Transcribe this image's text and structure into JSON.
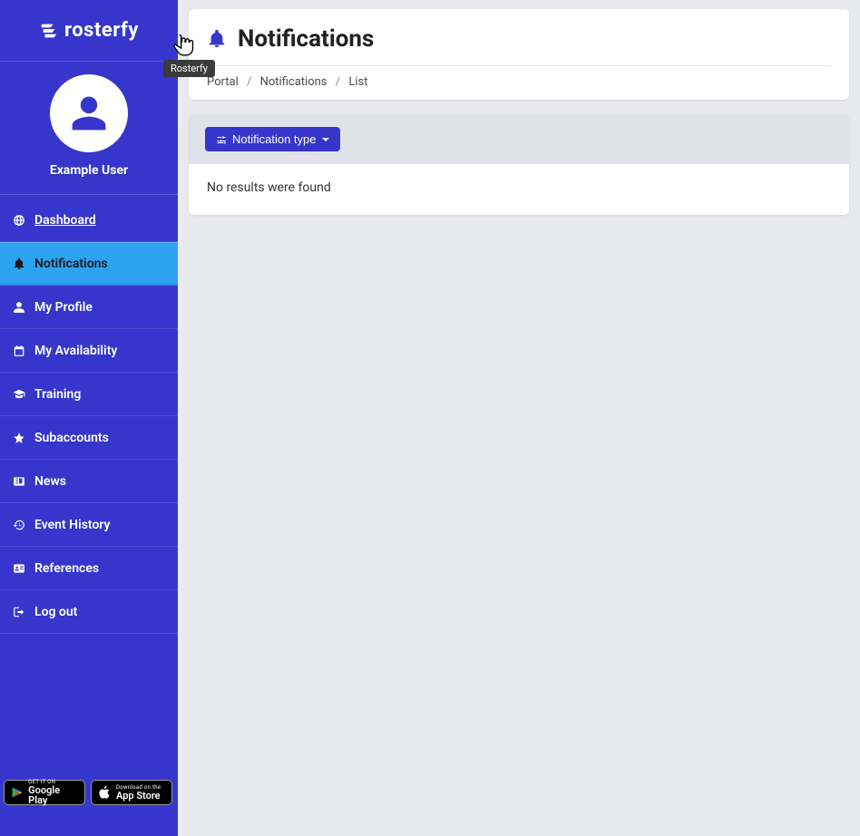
{
  "brand": {
    "name": "rosterfy",
    "tooltip": "Rosterfy"
  },
  "user": {
    "name": "Example User"
  },
  "sidebar": {
    "items": [
      {
        "id": "dashboard",
        "label": "Dashboard",
        "active": false
      },
      {
        "id": "notifications",
        "label": "Notifications",
        "active": true
      },
      {
        "id": "my-profile",
        "label": "My Profile",
        "active": false
      },
      {
        "id": "my-availability",
        "label": "My Availability",
        "active": false
      },
      {
        "id": "training",
        "label": "Training",
        "active": false
      },
      {
        "id": "subaccounts",
        "label": "Subaccounts",
        "active": false
      },
      {
        "id": "news",
        "label": "News",
        "active": false
      },
      {
        "id": "event-history",
        "label": "Event History",
        "active": false
      },
      {
        "id": "references",
        "label": "References",
        "active": false
      },
      {
        "id": "logout",
        "label": "Log out",
        "active": false
      }
    ]
  },
  "store": {
    "google": {
      "top": "GET IT ON",
      "bot": "Google Play"
    },
    "apple": {
      "top": "Download on the",
      "bot": "App Store"
    }
  },
  "page": {
    "title": "Notifications"
  },
  "breadcrumb": {
    "portal": "Portal",
    "notifications": "Notifications",
    "list": "List"
  },
  "filter": {
    "label": "Notification type"
  },
  "results": {
    "empty": "No results were found"
  }
}
